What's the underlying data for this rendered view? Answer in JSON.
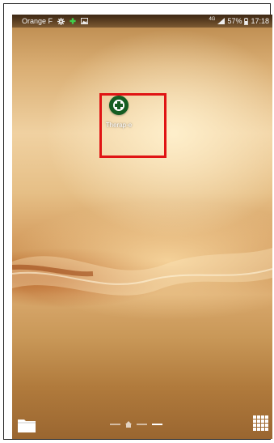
{
  "status_bar": {
    "carrier": "Orange F",
    "network": "4G",
    "battery": "57%",
    "time": "17:18",
    "icons": [
      "settings-gear-icon",
      "green-cross-notification-icon",
      "image-notification-icon",
      "signal-icon",
      "battery-icon"
    ]
  },
  "home": {
    "apps": [
      {
        "label": "Therap-e",
        "icon": "green-cross-icon",
        "highlighted": true
      }
    ]
  },
  "dock": {
    "left_icon": "folder-icon",
    "right_icon": "app-drawer-grid-icon",
    "pages": [
      "page-1",
      "home",
      "page-3",
      "page-4"
    ],
    "active_page": 3
  },
  "colors": {
    "highlight": "#e01414",
    "app_icon_bg": "#155d22"
  }
}
